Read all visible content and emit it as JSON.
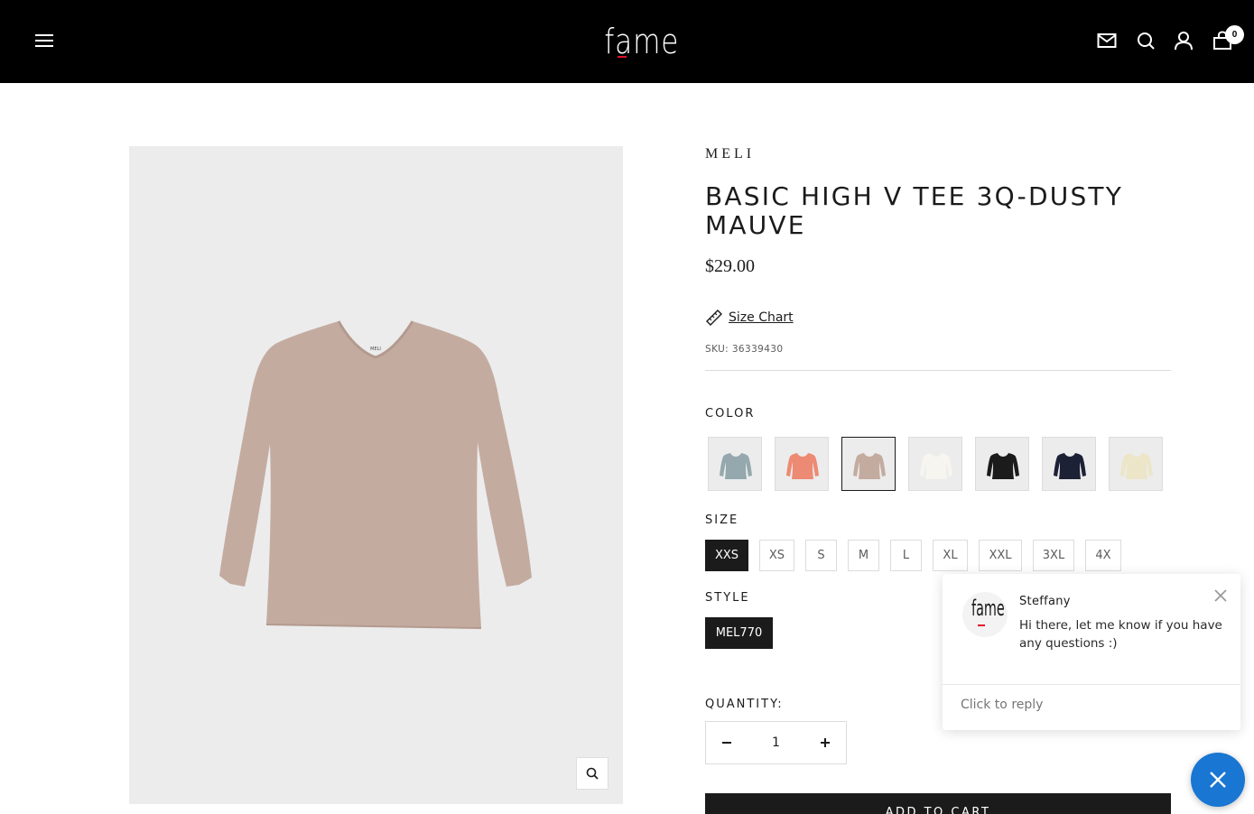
{
  "header": {
    "logo_text": "fame",
    "cart_count": "0",
    "icons": [
      "menu-icon",
      "mail-icon",
      "search-icon",
      "account-icon",
      "cart-icon"
    ]
  },
  "product": {
    "vendor": "MELI",
    "title": "BASIC HIGH V TEE 3Q-DUSTY MAUVE",
    "price": "$29.00",
    "size_chart_label": "Size Chart",
    "sku": "SKU: 36339430",
    "image_color": "#c4aba0",
    "image_tag_text": "MELI"
  },
  "color": {
    "label": "COLOR",
    "swatches": [
      {
        "name": "blue-grey",
        "color": "#94a8ad",
        "selected": false
      },
      {
        "name": "coral",
        "color": "#ec8a74",
        "selected": false
      },
      {
        "name": "dusty-mauve",
        "color": "#c4aba0",
        "selected": true
      },
      {
        "name": "white",
        "color": "#f7f5f0",
        "selected": false
      },
      {
        "name": "black",
        "color": "#1b1b1b",
        "selected": false
      },
      {
        "name": "navy",
        "color": "#1d2136",
        "selected": false
      },
      {
        "name": "cream",
        "color": "#ece5c8",
        "selected": false
      }
    ]
  },
  "size": {
    "label": "SIZE",
    "options": [
      "XXS",
      "XS",
      "S",
      "M",
      "L",
      "XL",
      "XXL",
      "3XL",
      "4X"
    ],
    "selected": "XXS"
  },
  "style": {
    "label": "STYLE",
    "option": "MEL770"
  },
  "quantity": {
    "label": "QUANTITY:",
    "value": "1"
  },
  "add_to_cart_label": "ADD TO CART",
  "chat": {
    "agent_name": "Steffany",
    "message": "Hi there, let me know if you have any questions :)",
    "reply_placeholder": "Click to reply",
    "avatar_text": "fame",
    "fab_color": "#1976d2"
  }
}
